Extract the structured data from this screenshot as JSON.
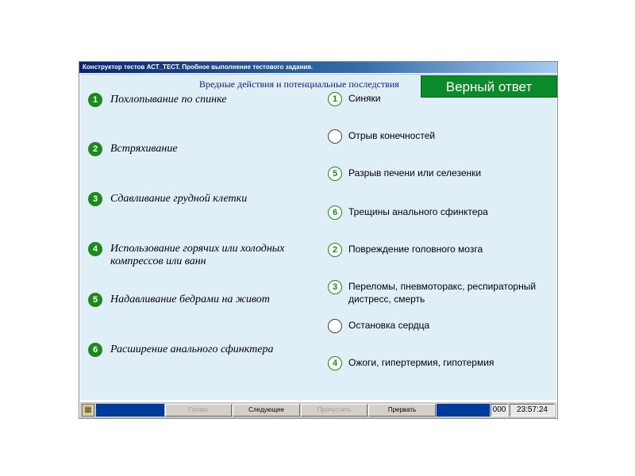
{
  "window": {
    "title": "Конструктор тестов АСТ_ТЕСТ. Пробное выполнение тестового задания."
  },
  "header": {
    "text": "Вредные действия и потенциальные последствия"
  },
  "verdict": {
    "label": "Верный ответ",
    "color": "#0a8a2a"
  },
  "left_items": [
    {
      "number": "1",
      "text": "Похлопывание по спинке"
    },
    {
      "number": "2",
      "text": "Встряхивание"
    },
    {
      "number": "3",
      "text": "Сдавливание грудной клетки"
    },
    {
      "number": "4",
      "text": "Использование горячих или холодных компрессов или ванн"
    },
    {
      "number": "5",
      "text": "Надавливание бедрами на живот"
    },
    {
      "number": "6",
      "text": "Расширение анального сфинктера"
    }
  ],
  "right_items": [
    {
      "slot": "1",
      "text": "Синяки"
    },
    {
      "slot": "",
      "text": "Отрыв конечностей"
    },
    {
      "slot": "5",
      "text": "Разрыв печени или селезенки"
    },
    {
      "slot": "6",
      "text": "Трещины анального сфинктера"
    },
    {
      "slot": "2",
      "text": "Повреждение головного мозга"
    },
    {
      "slot": "3",
      "text": "Переломы, пневмоторакс, респираторный дистресс, смерть"
    },
    {
      "slot": "",
      "text": "Остановка сердца"
    },
    {
      "slot": "4",
      "text": "Ожоги, гипертермия, гипотермия"
    }
  ],
  "statusbar": {
    "btn_ready": "Готово",
    "btn_next": "Следующее",
    "btn_skip": "Пропустить",
    "btn_abort": "Прервать",
    "counter": "000",
    "clock": "23:57:24",
    "icon": "calculator-icon"
  },
  "colors": {
    "badge_green": "#1b8a1b",
    "content_bg": "#dfeef7",
    "status_blue": "#003a9a"
  }
}
